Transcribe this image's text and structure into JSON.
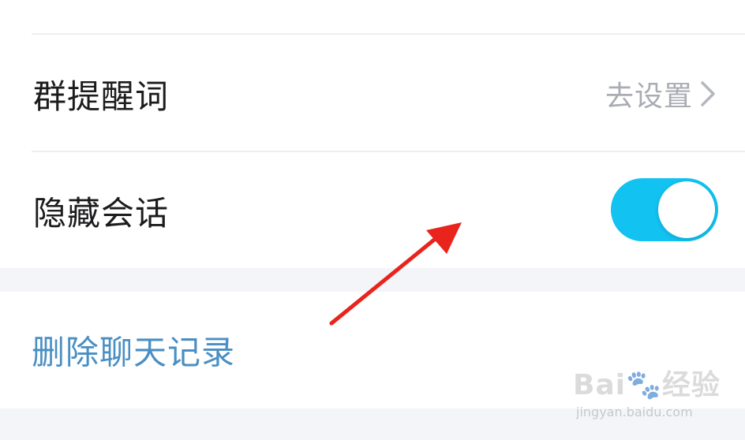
{
  "settings": {
    "group_keyword": {
      "label": "群提醒词",
      "action_label": "去设置"
    },
    "hide_chat": {
      "label": "隐藏会话",
      "toggle_on": true,
      "toggle_color": "#12c2f0"
    },
    "delete_history": {
      "label": "删除聊天记录",
      "color": "#4a8fc3"
    }
  },
  "annotation": {
    "arrow_color": "#e8241c"
  },
  "watermark": {
    "logo_text": "Bai🐾经验",
    "url": "jingyan.baidu.com"
  }
}
